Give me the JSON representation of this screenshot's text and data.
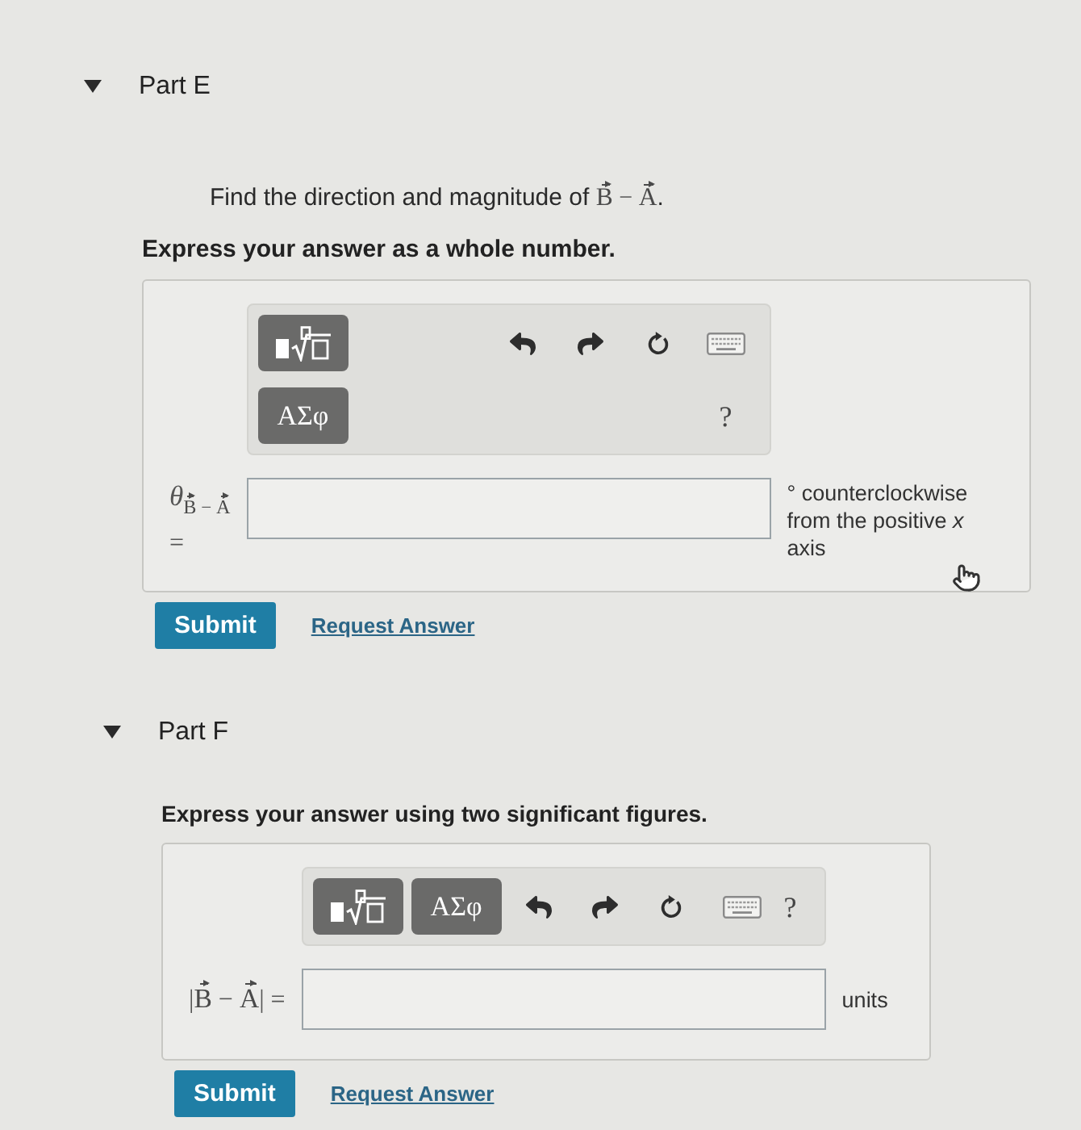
{
  "parts": [
    {
      "title": "Part E",
      "expanded": true,
      "prompt": [
        {
          "kind": "text",
          "text": "Find the direction and magnitude of "
        },
        {
          "kind": "vector",
          "text": "B"
        },
        {
          "kind": "op",
          "text": " − "
        },
        {
          "kind": "vector",
          "text": "A"
        },
        {
          "kind": "text",
          "text": "."
        }
      ],
      "instruction": "Express your answer as a whole number.",
      "toolbar": {
        "kind": "stacked",
        "tools": [
          {
            "kind": "templates"
          },
          {
            "kind": "symbols",
            "label": "ΑΣφ"
          },
          {
            "kind": "undo"
          },
          {
            "kind": "redo"
          },
          {
            "kind": "reset"
          },
          {
            "kind": "keyboard"
          },
          {
            "kind": "help",
            "label": "?"
          }
        ]
      },
      "answer": {
        "kind": "angle",
        "label": [
          {
            "kind": "italic",
            "text": "θ"
          },
          {
            "kind": "sub",
            "items": [
              {
                "kind": "vector",
                "text": "B"
              },
              {
                "kind": "op",
                "text": " − "
              },
              {
                "kind": "vector",
                "text": "A"
              }
            ]
          },
          {
            "kind": "op",
            "text": " ="
          }
        ],
        "units": "° counterclockwise from the positive *x* axis"
      },
      "submit": "Submit",
      "request_answer": "Request Answer"
    },
    {
      "title": "Part F",
      "expanded": true,
      "instruction": "Express your answer using two significant figures.",
      "toolbar": {
        "kind": "inline",
        "tools": [
          {
            "kind": "templates"
          },
          {
            "kind": "symbols",
            "label": "ΑΣφ"
          },
          {
            "kind": "undo"
          },
          {
            "kind": "redo"
          },
          {
            "kind": "reset"
          },
          {
            "kind": "keyboard"
          },
          {
            "kind": "help",
            "label": "?"
          }
        ]
      },
      "answer": {
        "kind": "magnitude",
        "label": [
          {
            "kind": "op",
            "text": "|"
          },
          {
            "kind": "vector",
            "text": "B"
          },
          {
            "kind": "op",
            "text": " − "
          },
          {
            "kind": "vector",
            "text": "A"
          },
          {
            "kind": "op",
            "text": "| ="
          }
        ],
        "units": "units"
      },
      "submit": "Submit",
      "request_answer": "Request Answer"
    }
  ]
}
